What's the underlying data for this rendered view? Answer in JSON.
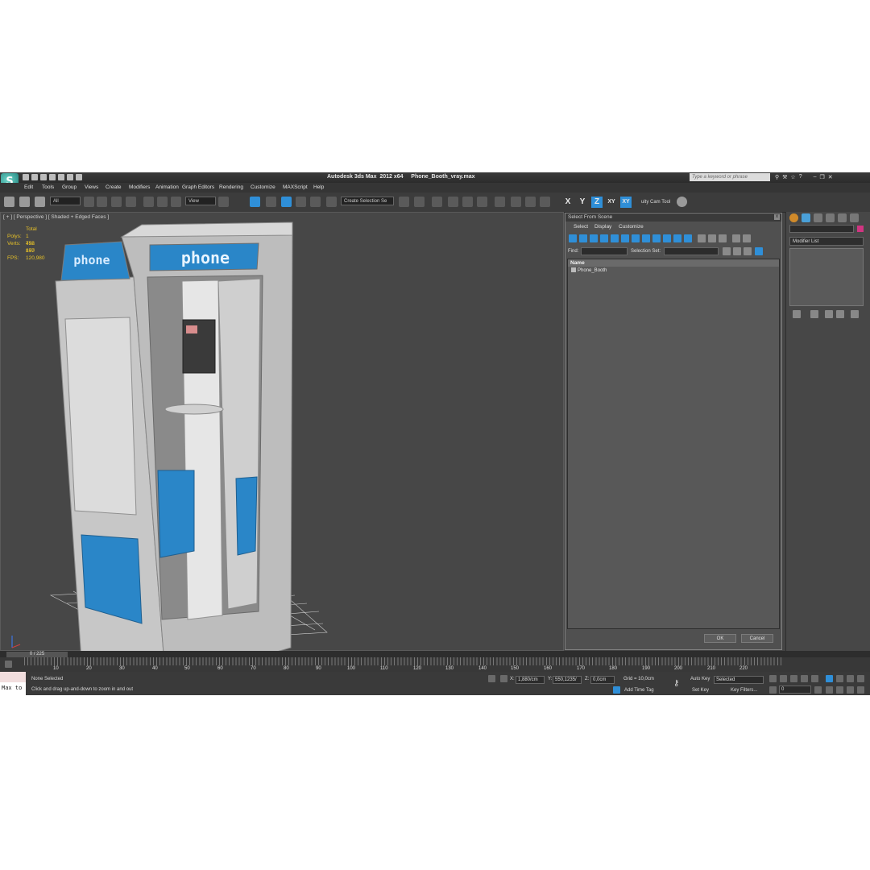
{
  "window": {
    "app_title": "Autodesk 3ds Max  2012 x64     Phone_Booth_vray.max",
    "search_placeholder": "Type a keyword or phrase",
    "logo_glyph": "S"
  },
  "menu": [
    "Edit",
    "Tools",
    "Group",
    "Views",
    "Create",
    "Modifiers",
    "Animation",
    "Graph Editors",
    "Rendering",
    "Customize",
    "MAXScript",
    "Help"
  ],
  "toolbar": {
    "selection_filter": "All",
    "ref_coord": "View",
    "selection_set": "Create Selection Se",
    "axes": [
      "X",
      "Y",
      "Z",
      "XY",
      "XY"
    ],
    "active_axis": "Z",
    "camera_tool": "uity Cam Tool"
  },
  "viewport": {
    "label": "[ + ] [ Perspective ] [ Shaded + Edged Faces ]",
    "stats_header": "Total",
    "stats": [
      {
        "label": "Polys:",
        "value": "1 492 160"
      },
      {
        "label": "Verts:",
        "value": "758 877"
      },
      {
        "label": "FPS:",
        "value": "120,980"
      }
    ],
    "sign_text": "phone"
  },
  "select_dialog": {
    "title": "Select From Scene",
    "close": "x",
    "menus": [
      "Select",
      "Display",
      "Customize"
    ],
    "find_label": "Find:",
    "selection_set_label": "Selection Set:",
    "column_name": "Name",
    "items": [
      "Phone_Booth"
    ],
    "ok": "OK",
    "cancel": "Cancel"
  },
  "command_panel": {
    "modifier_list": "Modifier List"
  },
  "timeline": {
    "frame_range": "0 / 225",
    "ticks": [
      "10",
      "20",
      "30",
      "40",
      "50",
      "60",
      "70",
      "80",
      "90",
      "100",
      "110",
      "120",
      "130",
      "140",
      "150",
      "160",
      "170",
      "180",
      "190",
      "200",
      "210",
      "220"
    ]
  },
  "status": {
    "maxscript_text": "Max to",
    "selection_status": "None Selected",
    "prompt": "Click and drag up-and-down to zoom in and out",
    "x_label": "X:",
    "x_value": "1,880/cm",
    "y_label": "Y:",
    "y_value": "550,1235/",
    "z_label": "Z:",
    "z_value": "0,0cm",
    "grid": "Grid = 10,0cm",
    "add_time_tag": "Add Time Tag",
    "auto_key": "Auto Key",
    "set_key": "Set Key",
    "key_mode": "Selected",
    "key_filters": "Key Filters...",
    "frame": "0"
  },
  "colors": {
    "accent_blue": "#2f8fd8",
    "stats_yellow": "#e8c228",
    "booth_blue": "#2a86c8",
    "color_swatch": "#d03581"
  }
}
